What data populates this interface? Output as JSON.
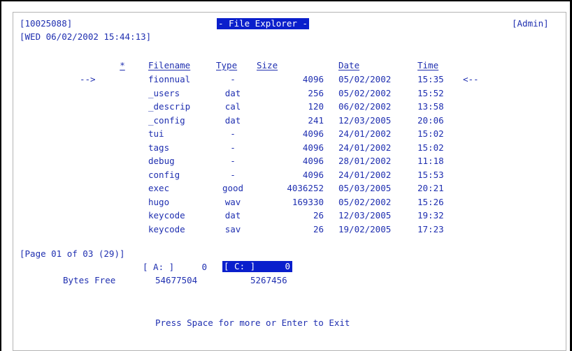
{
  "header": {
    "session_id": "[10025088]",
    "title": "- File Explorer -",
    "user": "[Admin]",
    "datetime": "[WED 06/02/2002 15:44:13]"
  },
  "table": {
    "columns": {
      "marker": "*",
      "filename": "Filename",
      "type": "Type",
      "size": "Size",
      "date": "Date",
      "time": "Time"
    },
    "cursor_left": "-->",
    "cursor_right": "<--",
    "rows": [
      {
        "filename": "fionnual",
        "type": "-",
        "size": "4096",
        "date": "05/02/2002",
        "time": "15:35"
      },
      {
        "filename": "_users",
        "type": "dat",
        "size": "256",
        "date": "05/02/2002",
        "time": "15:52"
      },
      {
        "filename": "_descrip",
        "type": "cal",
        "size": "120",
        "date": "06/02/2002",
        "time": "13:58"
      },
      {
        "filename": "_config",
        "type": "dat",
        "size": "241",
        "date": "12/03/2005",
        "time": "20:06"
      },
      {
        "filename": "tui",
        "type": "-",
        "size": "4096",
        "date": "24/01/2002",
        "time": "15:02"
      },
      {
        "filename": "tags",
        "type": "-",
        "size": "4096",
        "date": "24/01/2002",
        "time": "15:02"
      },
      {
        "filename": "debug",
        "type": "-",
        "size": "4096",
        "date": "28/01/2002",
        "time": "11:18"
      },
      {
        "filename": "config",
        "type": "-",
        "size": "4096",
        "date": "24/01/2002",
        "time": "15:53"
      },
      {
        "filename": "exec",
        "type": "good",
        "size": "4036252",
        "date": "05/03/2005",
        "time": "20:21"
      },
      {
        "filename": "hugo",
        "type": "wav",
        "size": "169330",
        "date": "05/02/2002",
        "time": "15:26"
      },
      {
        "filename": "keycode",
        "type": "dat",
        "size": "26",
        "date": "12/03/2005",
        "time": "19:32"
      },
      {
        "filename": "keycode",
        "type": "sav",
        "size": "26",
        "date": "19/02/2005",
        "time": "17:23"
      }
    ]
  },
  "pagination": "[Page 01 of 03 (29)]",
  "drives": {
    "a_label": "[ A: ]",
    "a_count": "0",
    "c_label": "[ C: ]",
    "c_count": "0",
    "bytes_free_label": "Bytes Free",
    "a_bytes_free": "54677504",
    "c_bytes_free": "5267456"
  },
  "footer": "Press Space for more or Enter to Exit",
  "colors": {
    "text": "#1f2fb0",
    "highlight_bg": "#0a1fcc",
    "highlight_fg": "#ffffff"
  }
}
